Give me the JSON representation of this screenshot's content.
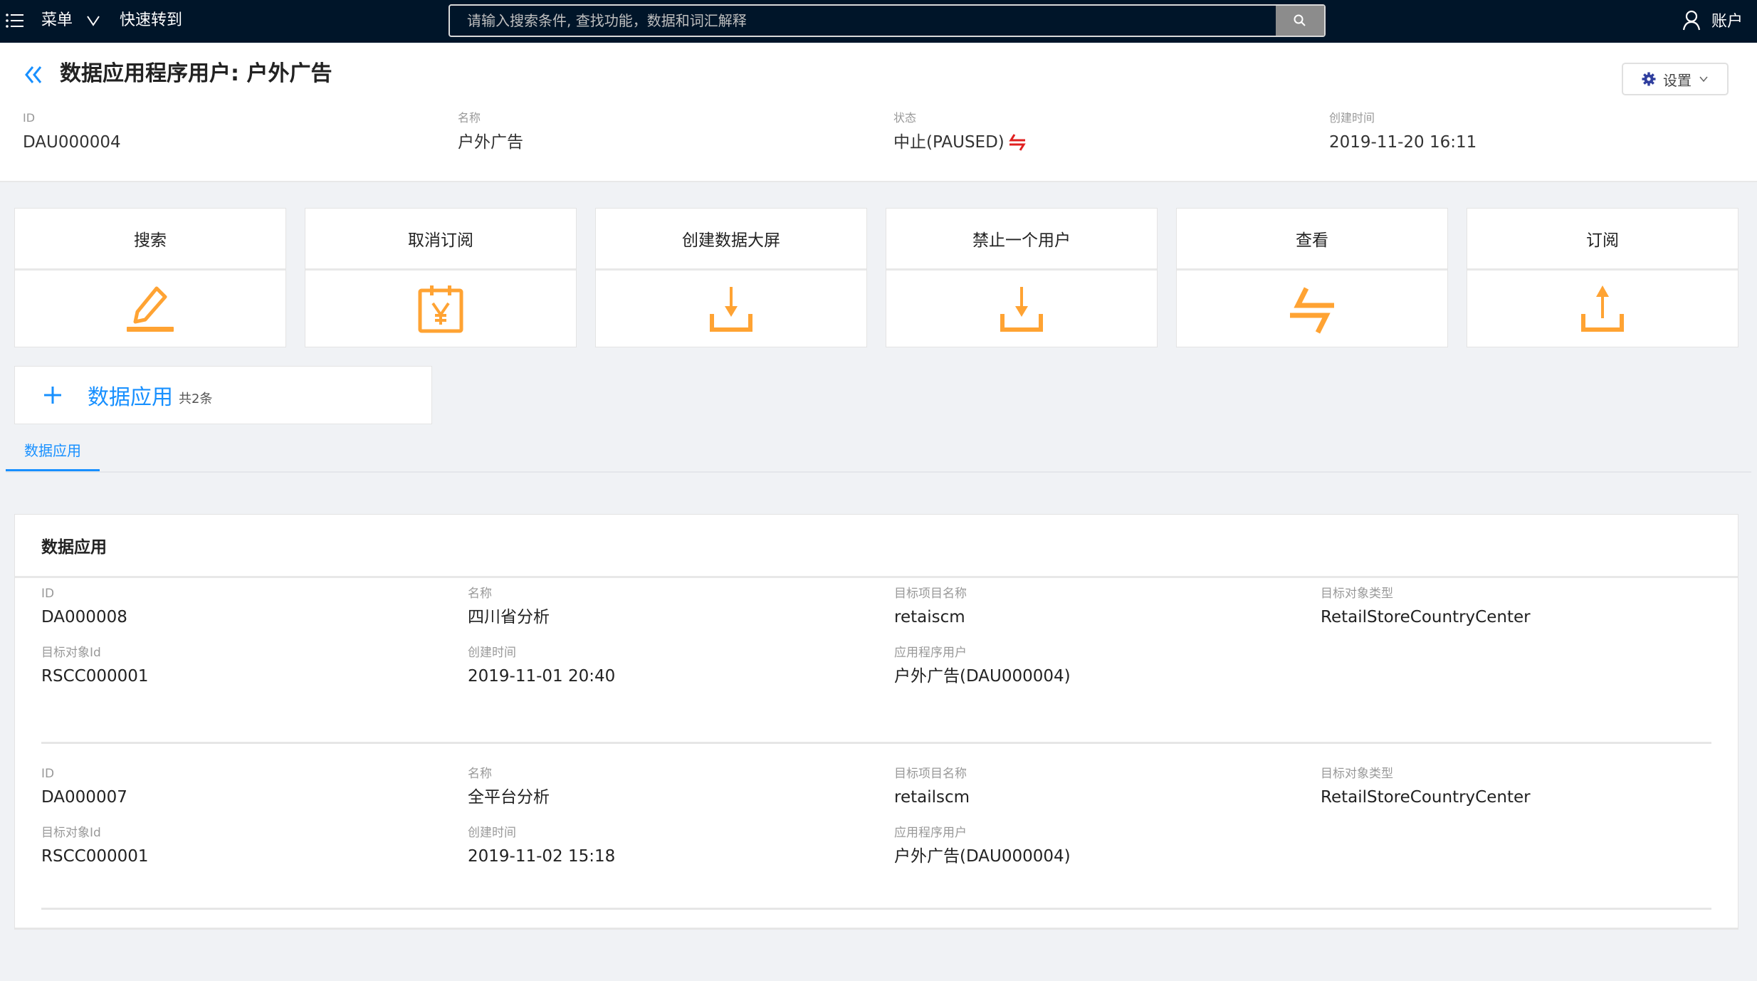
{
  "topbar": {
    "menu_label": "菜单",
    "goto_label": "快速转到",
    "search_placeholder": "请输入搜索条件, 查找功能，数据和词汇解释",
    "account_label": "账户"
  },
  "header": {
    "title": "数据应用程序用户: 户外广告",
    "settings_label": "设置",
    "fields": [
      {
        "label": "ID",
        "value": "DAU000004"
      },
      {
        "label": "名称",
        "value": "户外广告"
      },
      {
        "label": "状态",
        "value": "中止(PAUSED)"
      },
      {
        "label": "创建时间",
        "value": "2019-11-20 16:11"
      }
    ],
    "status_color": "#e02020"
  },
  "actions": [
    {
      "label": "搜索",
      "icon": "edit-icon"
    },
    {
      "label": "取消订阅",
      "icon": "calendar-yen-icon"
    },
    {
      "label": "创建数据大屏",
      "icon": "download-icon"
    },
    {
      "label": "禁止一个用户",
      "icon": "download-icon"
    },
    {
      "label": "查看",
      "icon": "swap-icon"
    },
    {
      "label": "订阅",
      "icon": "upload-icon"
    }
  ],
  "accent_color": "#1890ff",
  "icon_color": "#ffa333",
  "add_section": {
    "label": "数据应用",
    "count": "共2条"
  },
  "tabs": [
    {
      "label": "数据应用"
    }
  ],
  "list": {
    "title": "数据应用",
    "records": [
      {
        "fields": [
          {
            "label": "ID",
            "value": "DA000008"
          },
          {
            "label": "名称",
            "value": "四川省分析"
          },
          {
            "label": "目标项目名称",
            "value": "retaiscm"
          },
          {
            "label": "目标对象类型",
            "value": "RetailStoreCountryCenter"
          },
          {
            "label": "目标对象Id",
            "value": "RSCC000001"
          },
          {
            "label": "创建时间",
            "value": "2019-11-01 20:40"
          },
          {
            "label": "应用程序用户",
            "value": "户外广告(DAU000004)"
          }
        ]
      },
      {
        "fields": [
          {
            "label": "ID",
            "value": "DA000007"
          },
          {
            "label": "名称",
            "value": "全平台分析"
          },
          {
            "label": "目标项目名称",
            "value": "retailscm"
          },
          {
            "label": "目标对象类型",
            "value": "RetailStoreCountryCenter"
          },
          {
            "label": "目标对象Id",
            "value": "RSCC000001"
          },
          {
            "label": "创建时间",
            "value": "2019-11-02 15:18"
          },
          {
            "label": "应用程序用户",
            "value": "户外广告(DAU000004)"
          }
        ]
      }
    ]
  }
}
